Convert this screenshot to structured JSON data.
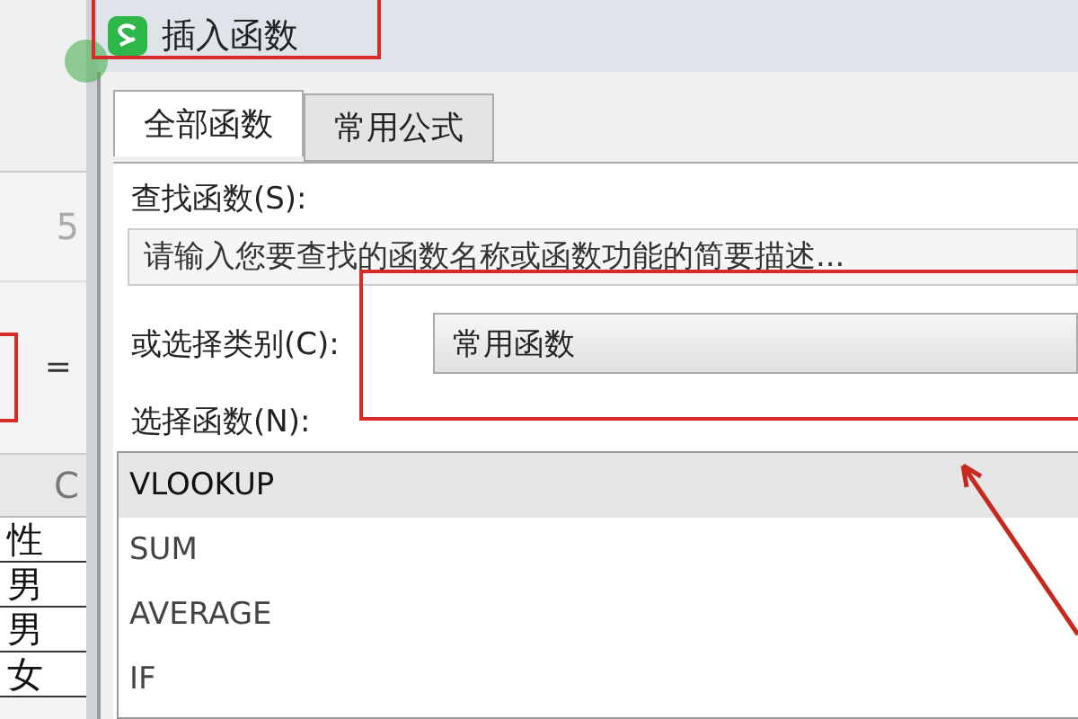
{
  "spreadsheet": {
    "toolbar_value": "5",
    "formula_sign": "=",
    "column_header": "C",
    "cells": [
      "性",
      "男",
      "男",
      "女"
    ]
  },
  "window": {
    "title": "插入函数"
  },
  "tabs": [
    {
      "label": "全部函数",
      "selected": true
    },
    {
      "label": "常用公式",
      "selected": false
    }
  ],
  "search": {
    "label": "查找函数(S):",
    "placeholder": "请输入您要查找的函数名称或函数功能的简要描述..."
  },
  "category": {
    "label": "或选择类别(C):",
    "value": "常用函数"
  },
  "functions": {
    "label": "选择函数(N):",
    "items": [
      {
        "name": "VLOOKUP",
        "selected": true
      },
      {
        "name": "SUM",
        "selected": false
      },
      {
        "name": "AVERAGE",
        "selected": false
      },
      {
        "name": "IF",
        "selected": false
      }
    ]
  }
}
